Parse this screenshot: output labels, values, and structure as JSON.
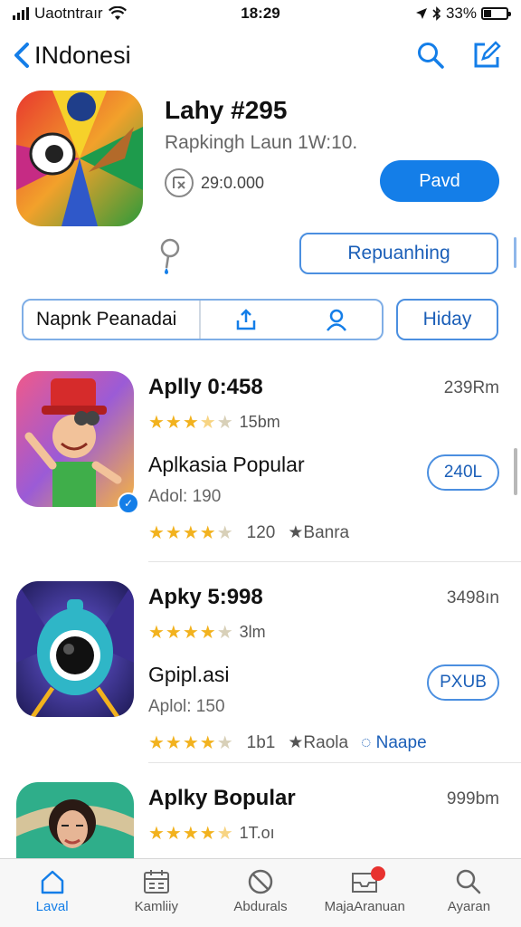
{
  "status_bar": {
    "carrier": "Uaotntraır",
    "time": "18:29",
    "battery": "33%",
    "battery_level": 0.33
  },
  "nav": {
    "back_label": "INdonesi",
    "icons": [
      "chevron-left-icon",
      "search-icon",
      "edit-icon"
    ]
  },
  "hero": {
    "title": "Lahy #295",
    "subtitle": "Rapkingh Laun 1W:10.",
    "stat": "29:0.000",
    "primary_button": "Pavd",
    "secondary_button": "Repuanhing"
  },
  "search": {
    "value": "Napnk Peanadai",
    "filter_button": "Hiday"
  },
  "apps": [
    {
      "name": "Aplly 0:458",
      "size": "239Rm",
      "rating": 3.5,
      "rating_text": "15bm",
      "subtitle": "Aplkasia Popular",
      "author": "Adol: 190",
      "button": "240L",
      "meta_rating": 4,
      "meta_count": "120",
      "meta_tag": "Banra",
      "meta_link": ""
    },
    {
      "name": "Apky 5:998",
      "size": "3498ın",
      "rating": 4,
      "rating_text": "3lm",
      "subtitle": "Gpipl.asi",
      "author": "Aplol: 150",
      "button": "PXUB",
      "meta_rating": 4,
      "meta_count": "1b1",
      "meta_tag": "Raola",
      "meta_link": "Naape"
    },
    {
      "name": "Aplky Bopular",
      "size": "999bm",
      "rating": 4.5,
      "rating_text": "1T.oı"
    }
  ],
  "tabs": [
    {
      "label": "Laval",
      "icon": "home-icon",
      "active": true
    },
    {
      "label": "Kamliiy",
      "icon": "calendar-icon",
      "active": false
    },
    {
      "label": "Abdurals",
      "icon": "blocked-icon",
      "active": false
    },
    {
      "label": "MajaAranuan",
      "icon": "inbox-icon",
      "active": false
    },
    {
      "label": "Ayaran",
      "icon": "search-icon",
      "active": false
    }
  ],
  "colors": {
    "accent": "#147ee8",
    "star": "#f2b21e",
    "badge": "#e8322f"
  }
}
